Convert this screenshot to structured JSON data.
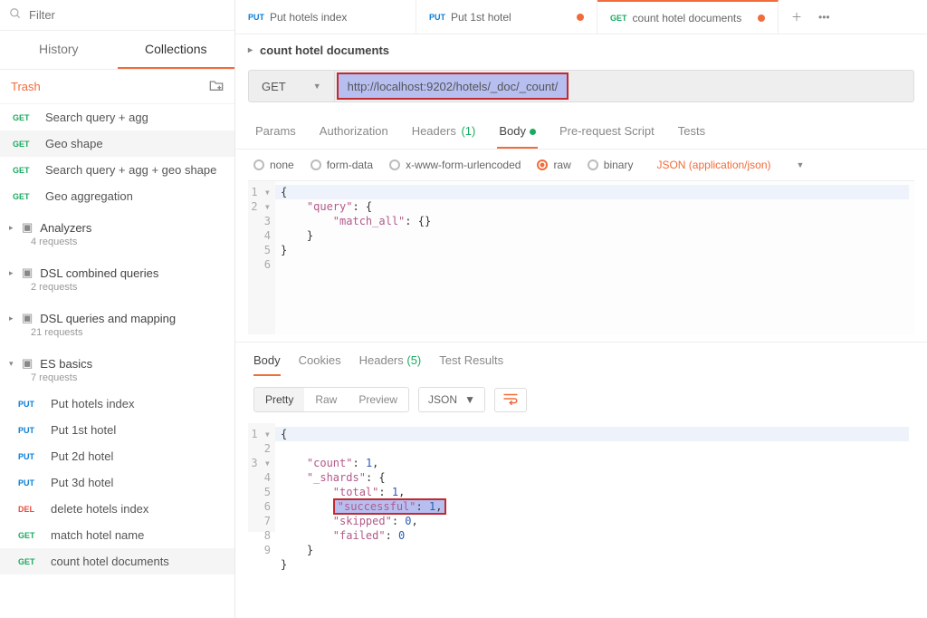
{
  "sidebar": {
    "filter_placeholder": "Filter",
    "tabs": {
      "history": "History",
      "collections": "Collections"
    },
    "trash": "Trash",
    "requests": [
      {
        "method": "GET",
        "name": "Search query + agg"
      },
      {
        "method": "GET",
        "name": "Geo shape"
      },
      {
        "method": "GET",
        "name": "Search query + agg + geo shape"
      },
      {
        "method": "GET",
        "name": "Geo aggregation"
      }
    ],
    "folders": [
      {
        "name": "Analyzers",
        "count": "4 requests"
      },
      {
        "name": "DSL combined queries",
        "count": "2 requests"
      },
      {
        "name": "DSL queries and mapping",
        "count": "21 requests"
      },
      {
        "name": "ES basics",
        "count": "7 requests"
      }
    ],
    "es_basics_items": [
      {
        "method": "PUT",
        "name": "Put hotels index"
      },
      {
        "method": "PUT",
        "name": "Put 1st hotel"
      },
      {
        "method": "PUT",
        "name": "Put 2d hotel"
      },
      {
        "method": "PUT",
        "name": "Put 3d hotel"
      },
      {
        "method": "DEL",
        "name": "delete hotels index"
      },
      {
        "method": "GET",
        "name": "match hotel name"
      },
      {
        "method": "GET",
        "name": "count hotel documents"
      }
    ]
  },
  "tabs": [
    {
      "method": "PUT",
      "label": "Put hotels index",
      "dirty": false
    },
    {
      "method": "PUT",
      "label": "Put 1st hotel",
      "dirty": true
    },
    {
      "method": "GET",
      "label": "count hotel documents",
      "dirty": true
    }
  ],
  "request": {
    "title": "count hotel documents",
    "method": "GET",
    "url": "http://localhost:9202/hotels/_doc/_count/",
    "req_tabs": {
      "params": "Params",
      "auth": "Authorization",
      "headers": "Headers",
      "headers_count": "(1)",
      "body": "Body",
      "prereq": "Pre-request Script",
      "tests": "Tests"
    },
    "body_types": {
      "none": "none",
      "form": "form-data",
      "urlenc": "x-www-form-urlencoded",
      "raw": "raw",
      "binary": "binary"
    },
    "content_type": "JSON (application/json)"
  },
  "request_body": {
    "lines": [
      "1",
      "2",
      "3",
      "4",
      "5",
      "6"
    ],
    "code": "{\n    \"query\": {\n        \"match_all\": {}\n    }\n}"
  },
  "response": {
    "tabs": {
      "body": "Body",
      "cookies": "Cookies",
      "headers": "Headers",
      "headers_count": "(5)",
      "tests": "Test Results"
    },
    "view_modes": {
      "pretty": "Pretty",
      "raw": "Raw",
      "preview": "Preview"
    },
    "format": "JSON"
  },
  "response_body": {
    "lines": [
      "1",
      "2",
      "3",
      "4",
      "5",
      "6",
      "7",
      "8",
      "9"
    ],
    "data": {
      "count": 1,
      "shards_key": "_shards",
      "total": 1,
      "successful_key": "\"successful\"",
      "successful": 1,
      "skipped": 0,
      "failed": 0
    }
  },
  "chart_data": null
}
